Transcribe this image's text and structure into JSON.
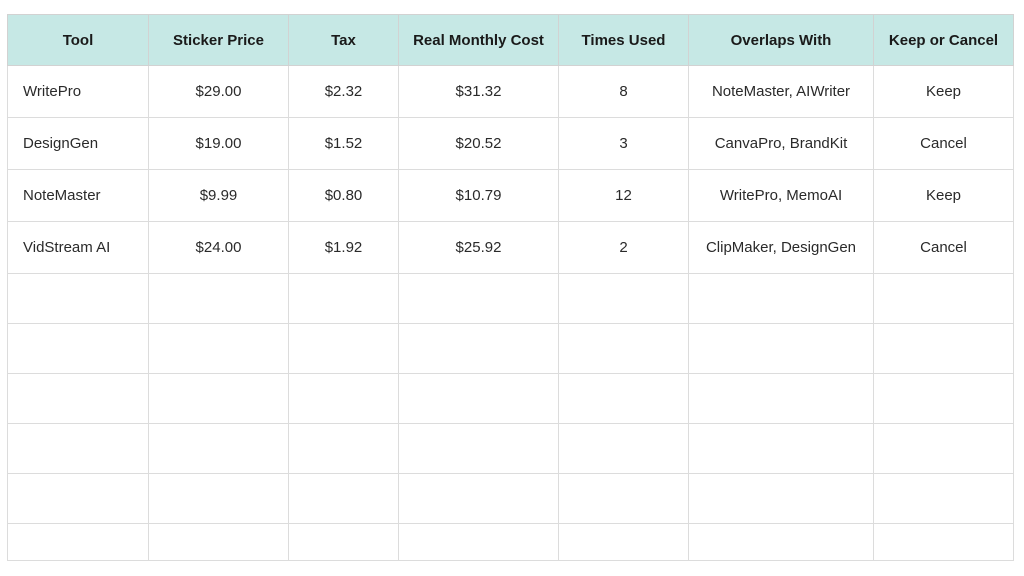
{
  "table": {
    "columns": [
      "Tool",
      "Sticker Price",
      "Tax",
      "Real Monthly Cost",
      "Times Used",
      "Overlaps With",
      "Keep or Cancel"
    ],
    "rows": [
      [
        "WritePro",
        "$29.00",
        "$2.32",
        "$31.32",
        "8",
        "NoteMaster, AIWriter",
        "Keep"
      ],
      [
        "DesignGen",
        "$19.00",
        "$1.52",
        "$20.52",
        "3",
        "CanvaPro, BrandKit",
        "Cancel"
      ],
      [
        "NoteMaster",
        "$9.99",
        "$0.80",
        "$10.79",
        "12",
        "WritePro, MemoAI",
        "Keep"
      ],
      [
        "VidStream AI",
        "$24.00",
        "$1.92",
        "$25.92",
        "2",
        "ClipMaker, DesignGen",
        "Cancel"
      ]
    ]
  }
}
